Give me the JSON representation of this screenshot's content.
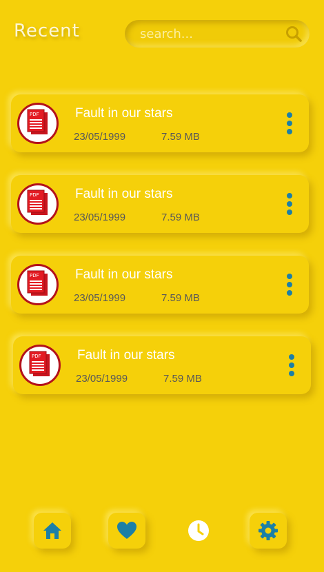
{
  "header": {
    "title": "Recent"
  },
  "search": {
    "placeholder": "search...",
    "icon": "search-icon"
  },
  "files": [
    {
      "name": "Fault in our stars",
      "date": "23/05/1999",
      "size": "7.59 MB",
      "icon": "pdf-icon",
      "badge": "PDF"
    },
    {
      "name": "Fault in our stars",
      "date": "23/05/1999",
      "size": "7.59 MB",
      "icon": "pdf-icon",
      "badge": "PDF"
    },
    {
      "name": "Fault in our stars",
      "date": "23/05/1999",
      "size": "7.59 MB",
      "icon": "pdf-icon",
      "badge": "PDF"
    },
    {
      "name": "Fault in our stars",
      "date": "23/05/1999",
      "size": "7.59 MB",
      "icon": "pdf-icon",
      "badge": "PDF"
    }
  ],
  "bottom_nav": [
    {
      "icon": "home-icon",
      "active": false
    },
    {
      "icon": "heart-icon",
      "active": false
    },
    {
      "icon": "clock-icon",
      "active": true
    },
    {
      "icon": "gear-icon",
      "active": false
    }
  ],
  "colors": {
    "background": "#f5d00a",
    "accent": "#1c7fa6",
    "pdf_red": "#c8141e",
    "text_light": "#ffffff",
    "text_dark": "#585858"
  }
}
